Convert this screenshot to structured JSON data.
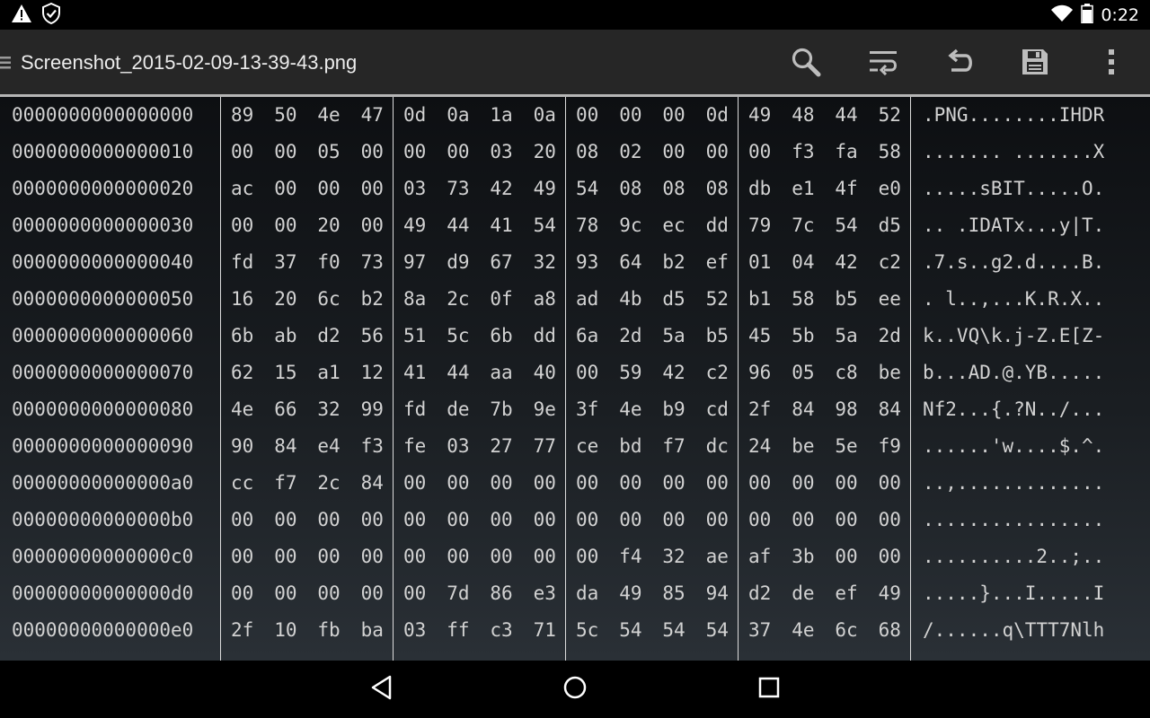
{
  "status": {
    "time": "0:22",
    "left_icons": [
      "warning-icon",
      "shield-icon"
    ],
    "right_icons": [
      "wifi-icon",
      "battery-icon"
    ]
  },
  "appbar": {
    "title": "Screenshot_2015-02-09-13-39-43.png",
    "actions": [
      "search-icon",
      "wrap-lines-icon",
      "undo-icon",
      "save-icon",
      "overflow-menu-icon"
    ]
  },
  "hex": {
    "rows": [
      {
        "offset": "0000000000000000",
        "bytes": [
          "89",
          "50",
          "4e",
          "47",
          "0d",
          "0a",
          "1a",
          "0a",
          "00",
          "00",
          "00",
          "0d",
          "49",
          "48",
          "44",
          "52"
        ],
        "ascii": ".PNG........IHDR"
      },
      {
        "offset": "0000000000000010",
        "bytes": [
          "00",
          "00",
          "05",
          "00",
          "00",
          "00",
          "03",
          "20",
          "08",
          "02",
          "00",
          "00",
          "00",
          "f3",
          "fa",
          "58"
        ],
        "ascii": "....... .......X"
      },
      {
        "offset": "0000000000000020",
        "bytes": [
          "ac",
          "00",
          "00",
          "00",
          "03",
          "73",
          "42",
          "49",
          "54",
          "08",
          "08",
          "08",
          "db",
          "e1",
          "4f",
          "e0"
        ],
        "ascii": ".....sBIT.....O."
      },
      {
        "offset": "0000000000000030",
        "bytes": [
          "00",
          "00",
          "20",
          "00",
          "49",
          "44",
          "41",
          "54",
          "78",
          "9c",
          "ec",
          "dd",
          "79",
          "7c",
          "54",
          "d5"
        ],
        "ascii": ".. .IDATx...y|T."
      },
      {
        "offset": "0000000000000040",
        "bytes": [
          "fd",
          "37",
          "f0",
          "73",
          "97",
          "d9",
          "67",
          "32",
          "93",
          "64",
          "b2",
          "ef",
          "01",
          "04",
          "42",
          "c2"
        ],
        "ascii": ".7.s..g2.d....B."
      },
      {
        "offset": "0000000000000050",
        "bytes": [
          "16",
          "20",
          "6c",
          "b2",
          "8a",
          "2c",
          "0f",
          "a8",
          "ad",
          "4b",
          "d5",
          "52",
          "b1",
          "58",
          "b5",
          "ee"
        ],
        "ascii": ". l..,...K.R.X.."
      },
      {
        "offset": "0000000000000060",
        "bytes": [
          "6b",
          "ab",
          "d2",
          "56",
          "51",
          "5c",
          "6b",
          "dd",
          "6a",
          "2d",
          "5a",
          "b5",
          "45",
          "5b",
          "5a",
          "2d"
        ],
        "ascii": "k..VQ\\k.j-Z.E[Z-"
      },
      {
        "offset": "0000000000000070",
        "bytes": [
          "62",
          "15",
          "a1",
          "12",
          "41",
          "44",
          "aa",
          "40",
          "00",
          "59",
          "42",
          "c2",
          "96",
          "05",
          "c8",
          "be"
        ],
        "ascii": "b...AD.@.YB....."
      },
      {
        "offset": "0000000000000080",
        "bytes": [
          "4e",
          "66",
          "32",
          "99",
          "fd",
          "de",
          "7b",
          "9e",
          "3f",
          "4e",
          "b9",
          "cd",
          "2f",
          "84",
          "98",
          "84"
        ],
        "ascii": "Nf2...{.?N../..."
      },
      {
        "offset": "0000000000000090",
        "bytes": [
          "90",
          "84",
          "e4",
          "f3",
          "fe",
          "03",
          "27",
          "77",
          "ce",
          "bd",
          "f7",
          "dc",
          "24",
          "be",
          "5e",
          "f9"
        ],
        "ascii": "......'w....$.^."
      },
      {
        "offset": "00000000000000a0",
        "bytes": [
          "cc",
          "f7",
          "2c",
          "84",
          "00",
          "00",
          "00",
          "00",
          "00",
          "00",
          "00",
          "00",
          "00",
          "00",
          "00",
          "00"
        ],
        "ascii": "..,............."
      },
      {
        "offset": "00000000000000b0",
        "bytes": [
          "00",
          "00",
          "00",
          "00",
          "00",
          "00",
          "00",
          "00",
          "00",
          "00",
          "00",
          "00",
          "00",
          "00",
          "00",
          "00"
        ],
        "ascii": "................"
      },
      {
        "offset": "00000000000000c0",
        "bytes": [
          "00",
          "00",
          "00",
          "00",
          "00",
          "00",
          "00",
          "00",
          "00",
          "f4",
          "32",
          "ae",
          "af",
          "3b",
          "00",
          "00"
        ],
        "ascii": "..........2..;.."
      },
      {
        "offset": "00000000000000d0",
        "bytes": [
          "00",
          "00",
          "00",
          "00",
          "00",
          "7d",
          "86",
          "e3",
          "da",
          "49",
          "85",
          "94",
          "d2",
          "de",
          "ef",
          "49"
        ],
        "ascii": ".....}...I.....I"
      },
      {
        "offset": "00000000000000e0",
        "bytes": [
          "2f",
          "10",
          "fb",
          "ba",
          "03",
          "ff",
          "c3",
          "71",
          "5c",
          "54",
          "54",
          "54",
          "37",
          "4e",
          "6c",
          "68"
        ],
        "ascii": "/......q\\TTT7Nlh"
      }
    ]
  },
  "navbar": {
    "buttons": [
      "back-icon",
      "home-icon",
      "recents-icon"
    ]
  }
}
